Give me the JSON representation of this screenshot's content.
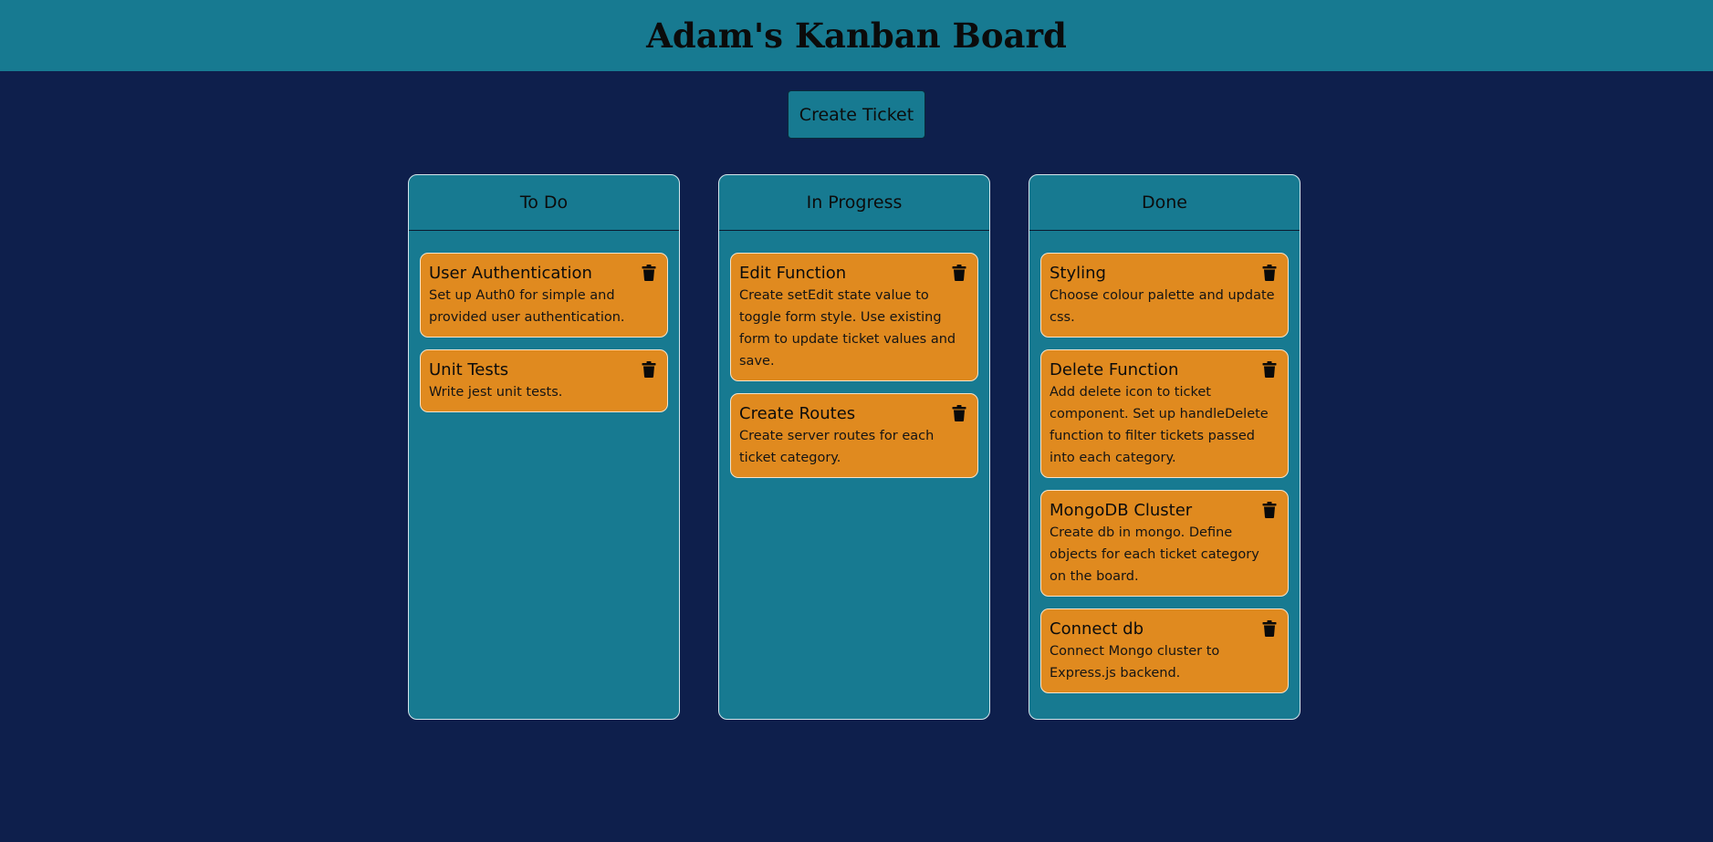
{
  "header": {
    "title": "Adam's Kanban Board"
  },
  "actions": {
    "create_label": "Create Ticket"
  },
  "colors": {
    "background": "#0e1f4c",
    "panel": "#177a91",
    "ticket": "#e08a1f"
  },
  "columns": [
    {
      "title": "To Do",
      "tickets": [
        {
          "title": "User Authentication",
          "description": "Set up Auth0 for simple and provided user authentication.",
          "icon": "trash-icon"
        },
        {
          "title": "Unit Tests",
          "description": "Write jest unit tests.",
          "icon": "trash-icon"
        }
      ]
    },
    {
      "title": "In Progress",
      "tickets": [
        {
          "title": "Edit Function",
          "description": "Create setEdit state value to toggle form style. Use existing form to update ticket values and save.",
          "icon": "trash-icon"
        },
        {
          "title": "Create Routes",
          "description": "Create server routes for each ticket category.",
          "icon": "trash-icon"
        }
      ]
    },
    {
      "title": "Done",
      "tickets": [
        {
          "title": "Styling",
          "description": "Choose colour palette and update css.",
          "icon": "trash-icon"
        },
        {
          "title": "Delete Function",
          "description": "Add delete icon to ticket component. Set up handleDelete function to filter tickets passed into each category.",
          "icon": "trash-icon"
        },
        {
          "title": "MongoDB Cluster",
          "description": "Create db in mongo. Define objects for each ticket category on the board.",
          "icon": "trash-icon"
        },
        {
          "title": "Connect db",
          "description": "Connect Mongo cluster to Express.js backend.",
          "icon": "trash-icon"
        }
      ]
    }
  ]
}
